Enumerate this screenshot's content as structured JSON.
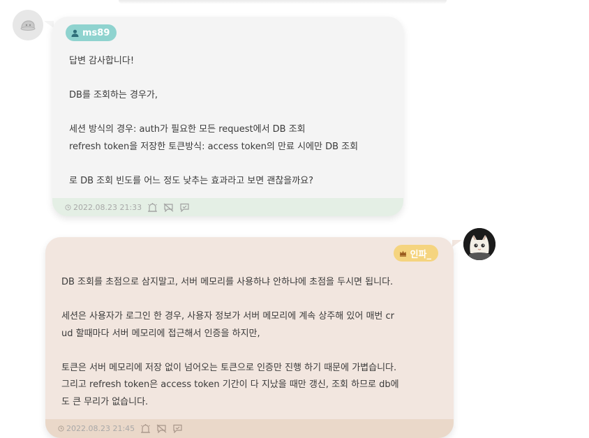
{
  "messages": [
    {
      "author": "ms89",
      "lines": [
        "답변 감사합니다!",
        "",
        "DB를 조회하는 경우가,",
        "",
        "세션 방식의 경우: auth가 필요한 모든 request에서 DB 조회",
        "refresh token을 저장한 토큰방식: access token의 만료 시에만 DB 조회",
        "",
        "로 DB 조회 빈도를 어느 정도 낮추는 효과라고 보면 괜찮을까요?"
      ],
      "timestamp": "2022.08.23 21:33",
      "colors": {
        "badge": "#8fd3cf",
        "bubble": "#f4f4f4",
        "footer": "#e4efe5"
      }
    },
    {
      "author": "인파_",
      "lines": [
        "DB 조회를 초점으로 삼지말고, 서버 메모리를 사용하냐 안하냐에 초점을 두시면 됩니다.",
        "",
        "세션은 사용자가 로그인 한 경우, 사용자 정보가 서버 메모리에 계속 상주해 있어 매번 cr",
        "ud 할때마다 서버 메모리에 접근해서 인증을 하지만,",
        "",
        "토큰은 서버 메모리에 저장 없이 넘어오는 토큰으로 인증만 진행 하기 때문에 가볍습니다.",
        "그리고 refresh token은 access token 기간이 다 지났을 때만 갱신, 조회 하므로 db에",
        "도 큰 무리가 없습니다."
      ],
      "timestamp": "2022.08.23 21:45",
      "colors": {
        "badge": "#f5d47f",
        "bubble": "#f2e6df",
        "footer": "#ead8c9"
      }
    }
  ],
  "icons": {
    "author_1": "person-icon",
    "author_2": "crown-icon",
    "actions": [
      "alarm-icon",
      "block-icon",
      "comment-icon"
    ]
  }
}
